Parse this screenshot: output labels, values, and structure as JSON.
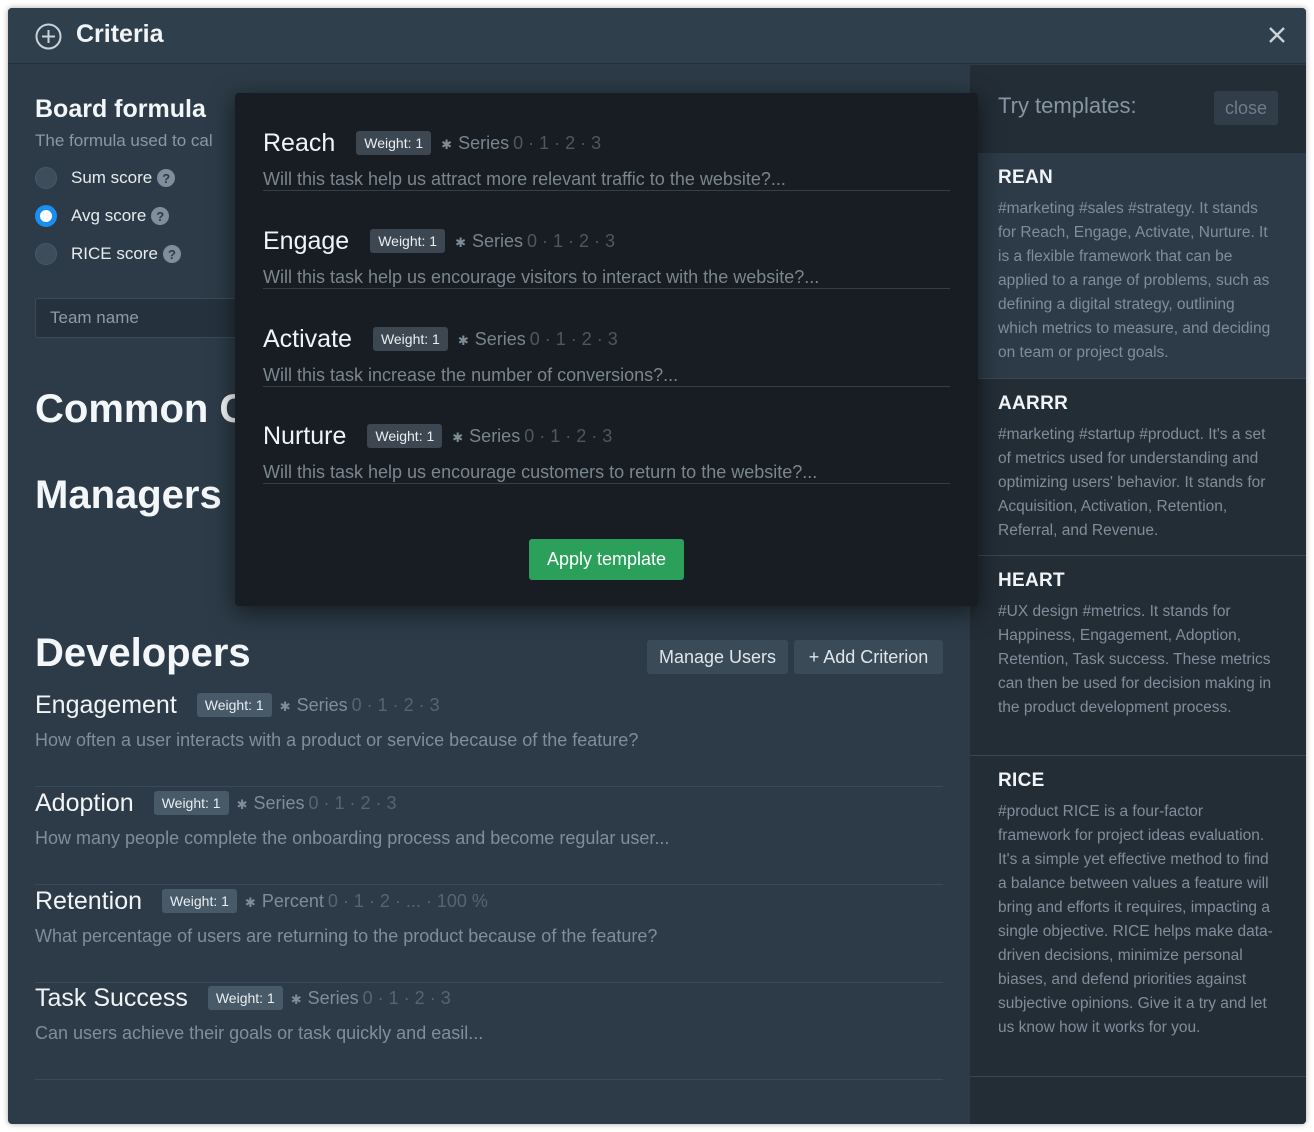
{
  "header": {
    "title": "Criteria"
  },
  "board": {
    "title": "Board formula",
    "subtitle": "The formula used to cal",
    "options": [
      {
        "label": "Sum score",
        "checked": false
      },
      {
        "label": "Avg score",
        "checked": true
      },
      {
        "label": "RICE score",
        "checked": false
      }
    ],
    "team_placeholder": "Team name"
  },
  "sections": {
    "common": "Common C",
    "managers": "Managers",
    "developers": "Developers"
  },
  "buttons": {
    "manage_users": "Manage Users",
    "add_criterion": "+ Add Criterion",
    "apply_template": "Apply template",
    "close": "close"
  },
  "developers_criteria": [
    {
      "name": "Engagement",
      "weight": "Weight: 1",
      "series": "Series",
      "values": "0 · 1 · 2 · 3",
      "desc": "How often a user interacts with a product or service because of the feature?"
    },
    {
      "name": "Adoption",
      "weight": "Weight: 1",
      "series": "Series",
      "values": "0 · 1 · 2 · 3",
      "desc": "How many people complete the onboarding process and become regular user..."
    },
    {
      "name": "Retention",
      "weight": "Weight: 1",
      "series": "Percent",
      "values": "0 · 1 · 2 · ... · 100 %",
      "desc": "What percentage of users are returning to the product because of the feature?"
    },
    {
      "name": "Task Success",
      "weight": "Weight: 1",
      "series": "Series",
      "values": "0 · 1 · 2 · 3",
      "desc": "Can users achieve their goals or task quickly and easil..."
    }
  ],
  "popup_criteria": [
    {
      "name": "Reach",
      "weight": "Weight: 1",
      "series": "Series",
      "values": "0 · 1 · 2 · 3",
      "desc": "Will this task help us attract more relevant traffic to the website?..."
    },
    {
      "name": "Engage",
      "weight": "Weight: 1",
      "series": "Series",
      "values": "0 · 1 · 2 · 3",
      "desc": "Will this task help us encourage visitors to interact with the website?..."
    },
    {
      "name": "Activate",
      "weight": "Weight: 1",
      "series": "Series",
      "values": "0 · 1 · 2 · 3",
      "desc": "Will this task increase the number of conversions?..."
    },
    {
      "name": "Nurture",
      "weight": "Weight: 1",
      "series": "Series",
      "values": "0 · 1 · 2 · 3",
      "desc": "Will this task help us encourage customers to return to the website?..."
    }
  ],
  "templates": {
    "heading": "Try templates:",
    "items": [
      {
        "name": "REAN",
        "desc": "#marketing #sales #strategy. It stands for Reach, Engage, Activate, Nurture. It is a flexible framework that can be applied to a range of problems, such as defining a digital strategy, outlining which metrics to measure, and deciding on team or project goals.",
        "active": true
      },
      {
        "name": "AARRR",
        "desc": "#marketing #startup #product. It's a set of metrics used for understanding and optimizing users' behavior. It stands for Acquisition, Activation, Retention, Referral, and Revenue.",
        "active": false
      },
      {
        "name": "HEART",
        "desc": "#UX design #metrics. It stands for Happiness, Engagement, Adoption, Retention, Task success. These metrics can then be used for decision making in the product development process.",
        "active": false
      },
      {
        "name": "RICE",
        "desc": "#product RICE is a four-factor framework for project ideas evaluation. It's a simple yet effective method to find a balance between values a feature will bring and efforts it requires, impacting a single objective. RICE helps make data-driven decisions, minimize personal biases, and defend priorities against subjective opinions. Give it a try and let us know how it works for you.",
        "active": false
      }
    ]
  },
  "colors": {
    "accent": "#1b8ff0",
    "apply": "#2aa05a",
    "panel": "#2c3b47",
    "sidebar": "#232d36",
    "popup": "#171d22"
  }
}
